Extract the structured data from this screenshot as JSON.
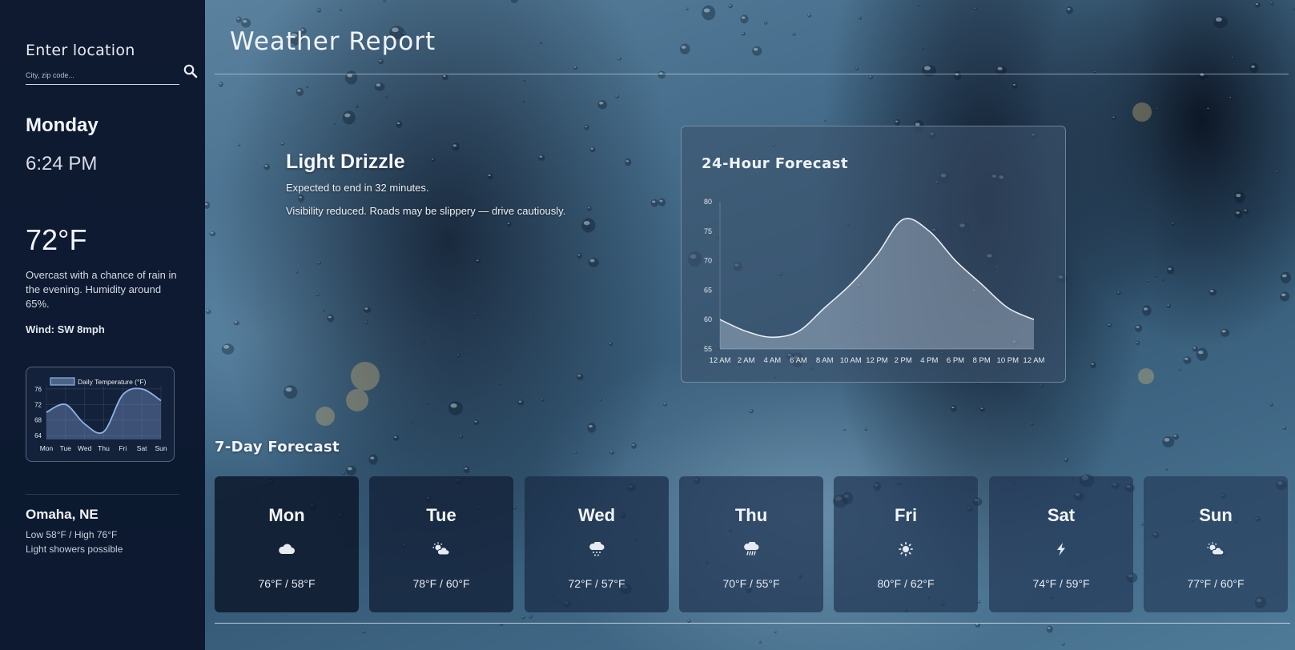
{
  "sidebar": {
    "location_label": "Enter location",
    "location_placeholder": "City, zip code...",
    "day": "Monday",
    "time": "6:24 PM",
    "temperature": "72°F",
    "description": "Overcast with a chance of rain in the evening. Humidity around 65%.",
    "wind": "Wind: SW 8mph",
    "city": "Omaha, NE",
    "low_high": "Low 58°F / High 76°F",
    "note": "Light showers possible"
  },
  "header": {
    "title": "Weather Report"
  },
  "condition": {
    "title": "Light Drizzle",
    "line1": "Expected to end in 32 minutes.",
    "line2": "Visibility reduced. Roads may be slippery — drive cautiously."
  },
  "forecast_panel": {
    "title": "24-Hour Forecast"
  },
  "week": {
    "title": "7-Day Forecast",
    "days": [
      {
        "name": "Mon",
        "icon": "cloud-icon",
        "range": "76°F / 58°F"
      },
      {
        "name": "Tue",
        "icon": "sun-cloud-icon",
        "range": "78°F / 60°F"
      },
      {
        "name": "Wed",
        "icon": "rain-icon",
        "range": "72°F / 57°F"
      },
      {
        "name": "Thu",
        "icon": "heavy-rain-icon",
        "range": "70°F / 55°F"
      },
      {
        "name": "Fri",
        "icon": "sun-icon",
        "range": "80°F / 62°F"
      },
      {
        "name": "Sat",
        "icon": "lightning-icon",
        "range": "74°F / 59°F"
      },
      {
        "name": "Sun",
        "icon": "sun-cloud-icon",
        "range": "77°F / 60°F"
      }
    ]
  },
  "colors": {
    "sidebar_bg": "#0f1a30",
    "day_card_bg": "#1c2d4b",
    "chart_line": "#e8edf3",
    "mini_chart_line": "#8fb3e6"
  },
  "chart_data": [
    {
      "type": "area",
      "title": "24-Hour Forecast",
      "x": [
        "12 AM",
        "2 AM",
        "4 AM",
        "6 AM",
        "8 AM",
        "10 AM",
        "12 PM",
        "2 PM",
        "4 PM",
        "6 PM",
        "8 PM",
        "10 PM",
        "12 AM"
      ],
      "values": [
        60,
        58,
        57,
        58,
        62,
        66,
        71,
        77,
        75,
        70,
        66,
        62,
        60
      ],
      "y_ticks": [
        80,
        75,
        70,
        65,
        60,
        55
      ],
      "ylim": [
        55,
        80
      ],
      "grid": false
    },
    {
      "type": "area",
      "legend": "Daily Temperature (°F)",
      "legend_position": "top",
      "categories": [
        "Mon",
        "Tue",
        "Wed",
        "Thu",
        "Fri",
        "Sat",
        "Sun"
      ],
      "values": [
        70,
        72,
        67,
        65,
        74.5,
        76,
        73
      ],
      "y_ticks": [
        76,
        72,
        68,
        64
      ],
      "ylim": [
        63,
        77
      ],
      "grid": true
    }
  ]
}
